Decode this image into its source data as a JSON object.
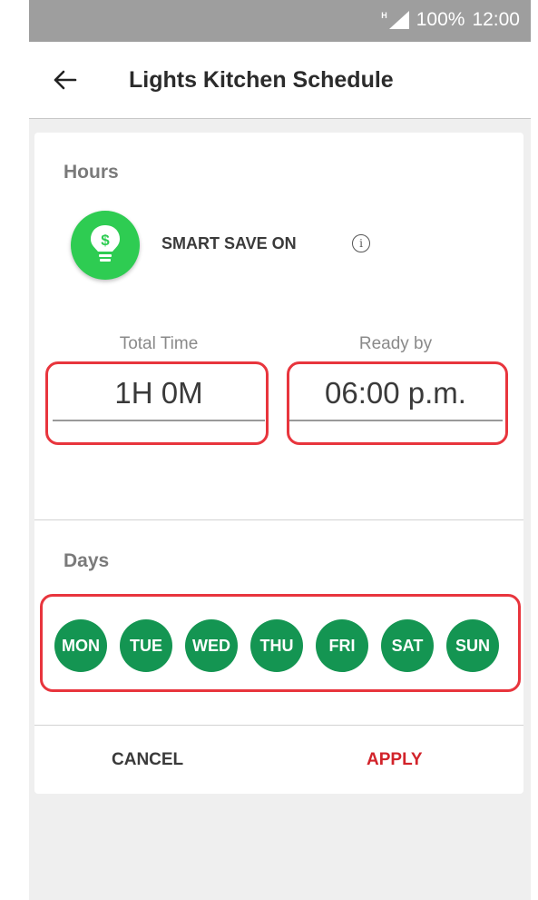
{
  "status_bar": {
    "network": "H",
    "battery": "100%",
    "time": "12:00"
  },
  "app_bar": {
    "back_icon": "arrow-left-icon",
    "title": "Lights Kitchen Schedule"
  },
  "hours_section": {
    "heading": "Hours",
    "smart_save_icon": "lightbulb-dollar-icon",
    "smart_save_label": "SMART SAVE ON",
    "info_icon": "info-icon",
    "total_time": {
      "label": "Total Time",
      "value": "1H 0M"
    },
    "ready_by": {
      "label": "Ready by",
      "value": "06:00 p.m."
    }
  },
  "days_section": {
    "heading": "Days",
    "days": [
      "MON",
      "TUE",
      "WED",
      "THU",
      "FRI",
      "SAT",
      "SUN"
    ]
  },
  "actions": {
    "cancel": "CANCEL",
    "apply": "APPLY"
  },
  "colors": {
    "accent_green": "#149552",
    "bulb_green": "#2ecc52",
    "apply_red": "#d2232a",
    "highlight_red": "#e8353d",
    "status_bar": "#9e9e9e"
  }
}
